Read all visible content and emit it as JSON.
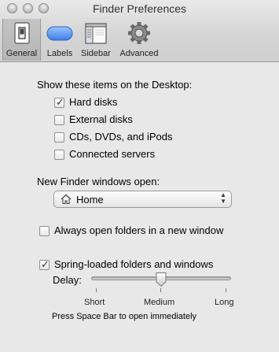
{
  "window": {
    "title": "Finder Preferences"
  },
  "toolbar": {
    "items": [
      {
        "label": "General",
        "icon": "general-switch-icon",
        "selected": true
      },
      {
        "label": "Labels",
        "icon": "labels-pill-icon"
      },
      {
        "label": "Sidebar",
        "icon": "sidebar-window-icon"
      },
      {
        "label": "Advanced",
        "icon": "gear-icon"
      }
    ]
  },
  "desktop": {
    "heading": "Show these items on the Desktop:",
    "items": [
      {
        "label": "Hard disks",
        "checked": true
      },
      {
        "label": "External disks",
        "checked": false
      },
      {
        "label": "CDs, DVDs, and iPods",
        "checked": false
      },
      {
        "label": "Connected servers",
        "checked": false
      }
    ]
  },
  "new_window": {
    "heading": "New Finder windows open:",
    "selected": "Home",
    "icon": "home-icon"
  },
  "always_open": {
    "label": "Always open folders in a new window",
    "checked": false
  },
  "spring_loaded": {
    "label": "Spring-loaded folders and windows",
    "checked": true,
    "delay_label": "Delay:",
    "delay_value": 0.5,
    "ticks": [
      "Short",
      "Medium",
      "Long"
    ],
    "hint": "Press Space Bar to open immediately"
  },
  "colors": {
    "checkmark": "#333333",
    "toolbar_selected": "#b8b8b8",
    "labels_pill": "#4a8be8"
  }
}
